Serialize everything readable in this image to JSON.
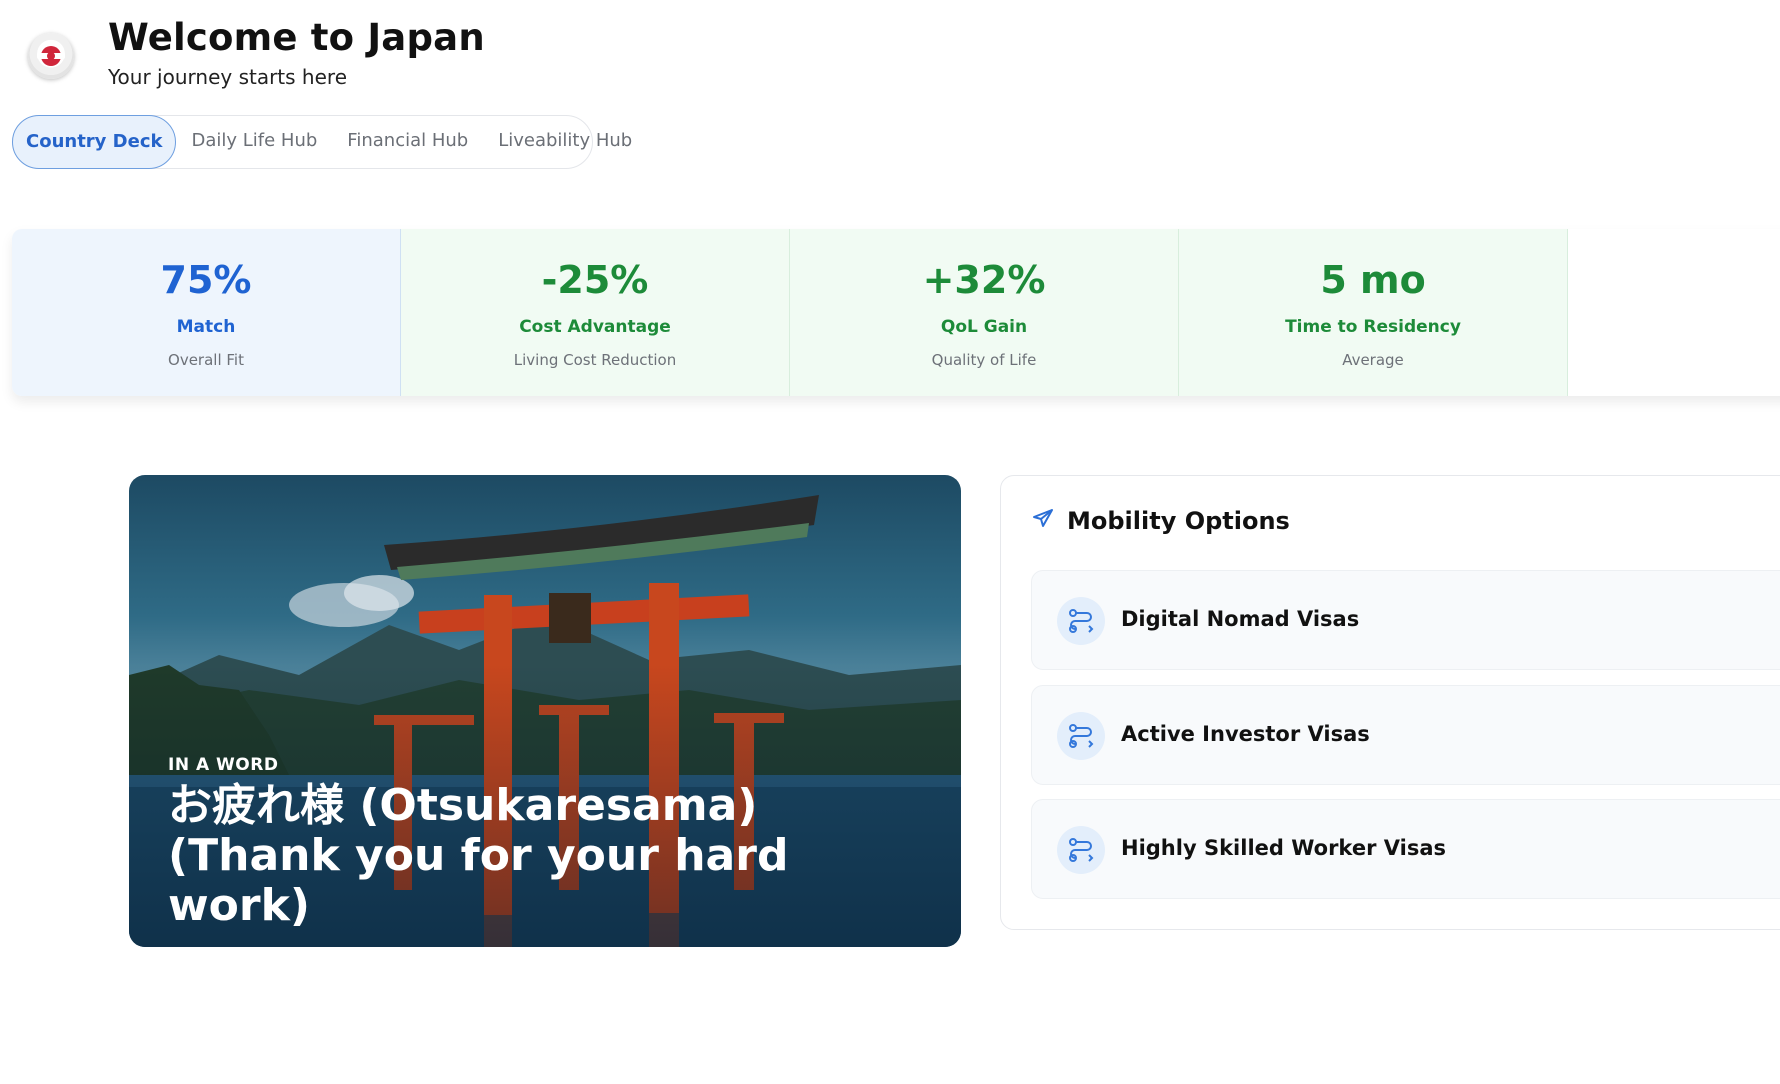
{
  "header": {
    "title": "Welcome to Japan",
    "subtitle": "Your journey starts here",
    "logo_icon": "japan-flag-icon"
  },
  "tabs": [
    {
      "label": "Country Deck",
      "active": true
    },
    {
      "label": "Daily Life Hub",
      "active": false
    },
    {
      "label": "Financial Hub",
      "active": false
    },
    {
      "label": "Liveability Hub",
      "active": false
    }
  ],
  "stats": [
    {
      "value": "75%",
      "label": "Match",
      "sub": "Overall Fit",
      "color": "#1f63d2"
    },
    {
      "value": "-25%",
      "label": "Cost Advantage",
      "sub": "Living Cost Reduction",
      "color": "#1d8b39"
    },
    {
      "value": "+32%",
      "label": "QoL Gain",
      "sub": "Quality of Life",
      "color": "#1d8b39"
    },
    {
      "value": "5 mo",
      "label": "Time to Residency",
      "sub": "Average",
      "color": "#1d8b39"
    }
  ],
  "hero": {
    "kicker": "IN A WORD",
    "phrase": "お疲れ様 (Otsukaresama) (Thank you for your hard work)"
  },
  "mobility": {
    "title": "Mobility Options",
    "title_icon": "plane-icon",
    "items": [
      {
        "label": "Digital Nomad Visas",
        "icon": "route-icon"
      },
      {
        "label": "Active Investor Visas",
        "icon": "route-icon"
      },
      {
        "label": "Highly Skilled Worker Visas",
        "icon": "route-icon"
      }
    ]
  }
}
